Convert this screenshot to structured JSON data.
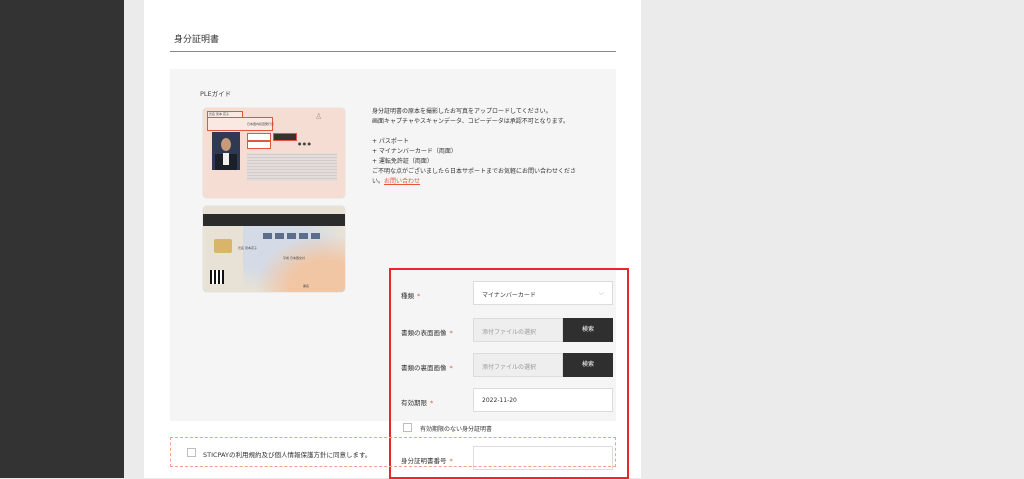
{
  "section_title": "身分証明書",
  "guide_label": "PLEガイド",
  "id_card_front": {
    "name_label": "氏名",
    "name_value": "見本 花子",
    "date_label": "日本国内初回発行日",
    "validity_label": "有効期限",
    "number_label": "個人番号"
  },
  "id_card_back": {
    "back_name": "氏名 見本花子",
    "issue_label": "平成 日本国交付",
    "seal_label": "署名"
  },
  "instructions": {
    "line1": "身分証明書の原本を撮影したお写真をアップロードしてください。",
    "line2": "画面キャプチャやスキャンデータ、コピーデータは承認不可となります。",
    "list": [
      "+ パスポート",
      "+ マイナンバーカード（両面）",
      "+ 運転免許証（両面）"
    ],
    "support_line": "ご不明な点がございましたら日本サポートまでお気軽にお問い合わせくださ",
    "support_tail": "い。",
    "contact_link": "お問い合わせ"
  },
  "form": {
    "type_label": "種類",
    "type_value": "マイナンバーカード",
    "front_label": "書類の表面画像",
    "back_label": "書類の裏面画像",
    "file_placeholder": "添付ファイルの選択",
    "browse_label": "検索",
    "expiry_label": "有効期限",
    "expiry_value": "2022-11-20",
    "no_expiry_label": "有効期限のない身分証明書",
    "id_number_label": "身分証明書番号",
    "id_number_value": "",
    "required_mark": "*"
  },
  "terms": {
    "label": "STICPAYの利用規約及び個人情報保護方針に同意します。"
  },
  "colors": {
    "accent": "#e0573c",
    "highlight_border": "#e8262b",
    "button_bg": "#2f2f2f",
    "sidebar_bg": "#333333",
    "page_bg": "#ebebeb",
    "panel_bg": "#f5f5f5"
  }
}
